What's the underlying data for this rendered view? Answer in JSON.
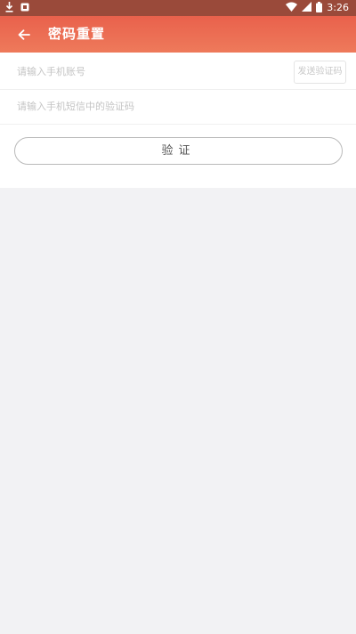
{
  "status_bar": {
    "time": "3:26",
    "left_icons": [
      "download-icon",
      "notification-icon"
    ],
    "right_icons": [
      "wifi-icon",
      "signal-icon",
      "battery-icon"
    ]
  },
  "app_bar": {
    "title": "密码重置",
    "back_icon": "back-arrow-icon"
  },
  "form": {
    "phone_placeholder": "请输入手机账号",
    "phone_value": "",
    "send_code_label": "发送验证码",
    "code_placeholder": "请输入手机短信中的验证码",
    "code_value": "",
    "verify_label": "验证"
  },
  "colors": {
    "app_bar_top": "#e9614c",
    "app_bar_bottom": "#ee7a5b",
    "status_bar": "#9a4a3a",
    "page_background": "#f2f2f4"
  }
}
